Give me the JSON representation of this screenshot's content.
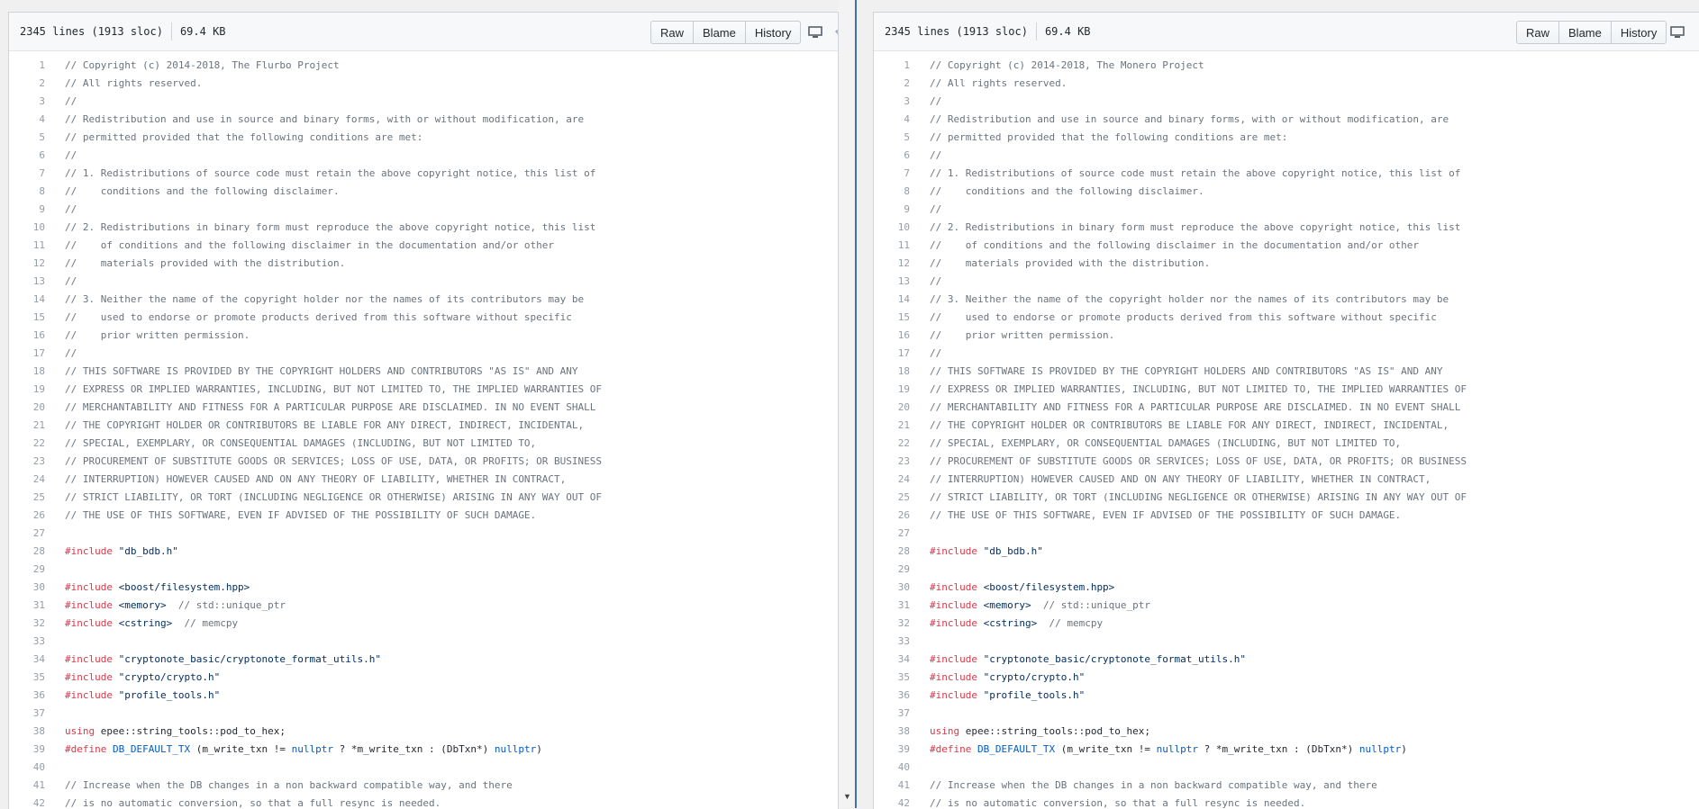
{
  "file_info": {
    "lines": "2345 lines (1913 sloc)",
    "size": "69.4 KB"
  },
  "buttons": {
    "raw": "Raw",
    "blame": "Blame",
    "history": "History"
  },
  "left": {
    "rows": [
      {
        "n": "1",
        "t": [
          {
            "c": "c",
            "v": "// Copyright (c) 2014-2018, The Flurbo Project"
          }
        ]
      },
      {
        "n": "2",
        "t": [
          {
            "c": "c",
            "v": "// All rights reserved."
          }
        ]
      },
      {
        "n": "3",
        "t": [
          {
            "c": "c",
            "v": "//"
          }
        ]
      },
      {
        "n": "4",
        "t": [
          {
            "c": "c",
            "v": "// Redistribution and use in source and binary forms, with or without modification, are"
          }
        ]
      },
      {
        "n": "5",
        "t": [
          {
            "c": "c",
            "v": "// permitted provided that the following conditions are met:"
          }
        ]
      },
      {
        "n": "6",
        "t": [
          {
            "c": "c",
            "v": "//"
          }
        ]
      },
      {
        "n": "7",
        "t": [
          {
            "c": "c",
            "v": "// 1. Redistributions of source code must retain the above copyright notice, this list of"
          }
        ]
      },
      {
        "n": "8",
        "t": [
          {
            "c": "c",
            "v": "//    conditions and the following disclaimer."
          }
        ]
      },
      {
        "n": "9",
        "t": [
          {
            "c": "c",
            "v": "//"
          }
        ]
      },
      {
        "n": "10",
        "t": [
          {
            "c": "c",
            "v": "// 2. Redistributions in binary form must reproduce the above copyright notice, this list"
          }
        ]
      },
      {
        "n": "11",
        "t": [
          {
            "c": "c",
            "v": "//    of conditions and the following disclaimer in the documentation and/or other"
          }
        ]
      },
      {
        "n": "12",
        "t": [
          {
            "c": "c",
            "v": "//    materials provided with the distribution."
          }
        ]
      },
      {
        "n": "13",
        "t": [
          {
            "c": "c",
            "v": "//"
          }
        ]
      },
      {
        "n": "14",
        "t": [
          {
            "c": "c",
            "v": "// 3. Neither the name of the copyright holder nor the names of its contributors may be"
          }
        ]
      },
      {
        "n": "15",
        "t": [
          {
            "c": "c",
            "v": "//    used to endorse or promote products derived from this software without specific"
          }
        ]
      },
      {
        "n": "16",
        "t": [
          {
            "c": "c",
            "v": "//    prior written permission."
          }
        ]
      },
      {
        "n": "17",
        "t": [
          {
            "c": "c",
            "v": "//"
          }
        ]
      },
      {
        "n": "18",
        "t": [
          {
            "c": "c",
            "v": "// THIS SOFTWARE IS PROVIDED BY THE COPYRIGHT HOLDERS AND CONTRIBUTORS \"AS IS\" AND ANY"
          }
        ]
      },
      {
        "n": "19",
        "t": [
          {
            "c": "c",
            "v": "// EXPRESS OR IMPLIED WARRANTIES, INCLUDING, BUT NOT LIMITED TO, THE IMPLIED WARRANTIES OF"
          }
        ]
      },
      {
        "n": "20",
        "t": [
          {
            "c": "c",
            "v": "// MERCHANTABILITY AND FITNESS FOR A PARTICULAR PURPOSE ARE DISCLAIMED. IN NO EVENT SHALL"
          }
        ]
      },
      {
        "n": "21",
        "t": [
          {
            "c": "c",
            "v": "// THE COPYRIGHT HOLDER OR CONTRIBUTORS BE LIABLE FOR ANY DIRECT, INDIRECT, INCIDENTAL,"
          }
        ]
      },
      {
        "n": "22",
        "t": [
          {
            "c": "c",
            "v": "// SPECIAL, EXEMPLARY, OR CONSEQUENTIAL DAMAGES (INCLUDING, BUT NOT LIMITED TO,"
          }
        ]
      },
      {
        "n": "23",
        "t": [
          {
            "c": "c",
            "v": "// PROCUREMENT OF SUBSTITUTE GOODS OR SERVICES; LOSS OF USE, DATA, OR PROFITS; OR BUSINESS"
          }
        ]
      },
      {
        "n": "24",
        "t": [
          {
            "c": "c",
            "v": "// INTERRUPTION) HOWEVER CAUSED AND ON ANY THEORY OF LIABILITY, WHETHER IN CONTRACT,"
          }
        ]
      },
      {
        "n": "25",
        "t": [
          {
            "c": "c",
            "v": "// STRICT LIABILITY, OR TORT (INCLUDING NEGLIGENCE OR OTHERWISE) ARISING IN ANY WAY OUT OF"
          }
        ]
      },
      {
        "n": "26",
        "t": [
          {
            "c": "c",
            "v": "// THE USE OF THIS SOFTWARE, EVEN IF ADVISED OF THE POSSIBILITY OF SUCH DAMAGE."
          }
        ]
      },
      {
        "n": "27",
        "t": []
      },
      {
        "n": "28",
        "t": [
          {
            "c": "k",
            "v": "#include"
          },
          {
            "c": "",
            "v": " "
          },
          {
            "c": "s",
            "v": "\"db_bdb.h\""
          }
        ]
      },
      {
        "n": "29",
        "t": []
      },
      {
        "n": "30",
        "t": [
          {
            "c": "k",
            "v": "#include"
          },
          {
            "c": "",
            "v": " "
          },
          {
            "c": "s",
            "v": "<boost/filesystem.hpp>"
          }
        ]
      },
      {
        "n": "31",
        "t": [
          {
            "c": "k",
            "v": "#include"
          },
          {
            "c": "",
            "v": " "
          },
          {
            "c": "s",
            "v": "<memory>"
          },
          {
            "c": "c",
            "v": "  // std::unique_ptr"
          }
        ]
      },
      {
        "n": "32",
        "t": [
          {
            "c": "k",
            "v": "#include"
          },
          {
            "c": "",
            "v": " "
          },
          {
            "c": "s",
            "v": "<cstring>"
          },
          {
            "c": "c",
            "v": "  // memcpy"
          }
        ]
      },
      {
        "n": "33",
        "t": []
      },
      {
        "n": "34",
        "t": [
          {
            "c": "k",
            "v": "#include"
          },
          {
            "c": "",
            "v": " "
          },
          {
            "c": "s",
            "v": "\"cryptonote_basic/cryptonote_format_utils.h\""
          }
        ]
      },
      {
        "n": "35",
        "t": [
          {
            "c": "k",
            "v": "#include"
          },
          {
            "c": "",
            "v": " "
          },
          {
            "c": "s",
            "v": "\"crypto/crypto.h\""
          }
        ]
      },
      {
        "n": "36",
        "t": [
          {
            "c": "k",
            "v": "#include"
          },
          {
            "c": "",
            "v": " "
          },
          {
            "c": "s",
            "v": "\"profile_tools.h\""
          }
        ]
      },
      {
        "n": "37",
        "t": []
      },
      {
        "n": "38",
        "t": [
          {
            "c": "k",
            "v": "using"
          },
          {
            "c": "",
            "v": " epee::string_tools::pod_to_hex;"
          }
        ]
      },
      {
        "n": "39",
        "t": [
          {
            "c": "k",
            "v": "#define"
          },
          {
            "c": "",
            "v": " "
          },
          {
            "c": "n",
            "v": "DB_DEFAULT_TX"
          },
          {
            "c": "",
            "v": " (m_write_txn != "
          },
          {
            "c": "n",
            "v": "nullptr"
          },
          {
            "c": "",
            "v": " ? *m_write_txn : (DbTxn*) "
          },
          {
            "c": "n",
            "v": "nullptr"
          },
          {
            "c": "",
            "v": ")"
          }
        ]
      },
      {
        "n": "40",
        "t": []
      },
      {
        "n": "41",
        "t": [
          {
            "c": "c",
            "v": "// Increase when the DB changes in a non backward compatible way, and there"
          }
        ]
      },
      {
        "n": "42",
        "t": [
          {
            "c": "c",
            "v": "// is no automatic conversion, so that a full resync is needed."
          }
        ]
      }
    ]
  },
  "right": {
    "rows": [
      {
        "n": "1",
        "t": [
          {
            "c": "c",
            "v": "// Copyright (c) 2014-2018, The Monero Project"
          }
        ]
      },
      {
        "n": "2",
        "t": [
          {
            "c": "c",
            "v": "// All rights reserved."
          }
        ]
      },
      {
        "n": "3",
        "t": [
          {
            "c": "c",
            "v": "//"
          }
        ]
      },
      {
        "n": "4",
        "t": [
          {
            "c": "c",
            "v": "// Redistribution and use in source and binary forms, with or without modification, are"
          }
        ]
      },
      {
        "n": "5",
        "t": [
          {
            "c": "c",
            "v": "// permitted provided that the following conditions are met:"
          }
        ]
      },
      {
        "n": "6",
        "t": [
          {
            "c": "c",
            "v": "//"
          }
        ]
      },
      {
        "n": "7",
        "t": [
          {
            "c": "c",
            "v": "// 1. Redistributions of source code must retain the above copyright notice, this list of"
          }
        ]
      },
      {
        "n": "8",
        "t": [
          {
            "c": "c",
            "v": "//    conditions and the following disclaimer."
          }
        ]
      },
      {
        "n": "9",
        "t": [
          {
            "c": "c",
            "v": "//"
          }
        ]
      },
      {
        "n": "10",
        "t": [
          {
            "c": "c",
            "v": "// 2. Redistributions in binary form must reproduce the above copyright notice, this list"
          }
        ]
      },
      {
        "n": "11",
        "t": [
          {
            "c": "c",
            "v": "//    of conditions and the following disclaimer in the documentation and/or other"
          }
        ]
      },
      {
        "n": "12",
        "t": [
          {
            "c": "c",
            "v": "//    materials provided with the distribution."
          }
        ]
      },
      {
        "n": "13",
        "t": [
          {
            "c": "c",
            "v": "//"
          }
        ]
      },
      {
        "n": "14",
        "t": [
          {
            "c": "c",
            "v": "// 3. Neither the name of the copyright holder nor the names of its contributors may be"
          }
        ]
      },
      {
        "n": "15",
        "t": [
          {
            "c": "c",
            "v": "//    used to endorse or promote products derived from this software without specific"
          }
        ]
      },
      {
        "n": "16",
        "t": [
          {
            "c": "c",
            "v": "//    prior written permission."
          }
        ]
      },
      {
        "n": "17",
        "t": [
          {
            "c": "c",
            "v": "//"
          }
        ]
      },
      {
        "n": "18",
        "t": [
          {
            "c": "c",
            "v": "// THIS SOFTWARE IS PROVIDED BY THE COPYRIGHT HOLDERS AND CONTRIBUTORS \"AS IS\" AND ANY"
          }
        ]
      },
      {
        "n": "19",
        "t": [
          {
            "c": "c",
            "v": "// EXPRESS OR IMPLIED WARRANTIES, INCLUDING, BUT NOT LIMITED TO, THE IMPLIED WARRANTIES OF"
          }
        ]
      },
      {
        "n": "20",
        "t": [
          {
            "c": "c",
            "v": "// MERCHANTABILITY AND FITNESS FOR A PARTICULAR PURPOSE ARE DISCLAIMED. IN NO EVENT SHALL"
          }
        ]
      },
      {
        "n": "21",
        "t": [
          {
            "c": "c",
            "v": "// THE COPYRIGHT HOLDER OR CONTRIBUTORS BE LIABLE FOR ANY DIRECT, INDIRECT, INCIDENTAL,"
          }
        ]
      },
      {
        "n": "22",
        "t": [
          {
            "c": "c",
            "v": "// SPECIAL, EXEMPLARY, OR CONSEQUENTIAL DAMAGES (INCLUDING, BUT NOT LIMITED TO,"
          }
        ]
      },
      {
        "n": "23",
        "t": [
          {
            "c": "c",
            "v": "// PROCUREMENT OF SUBSTITUTE GOODS OR SERVICES; LOSS OF USE, DATA, OR PROFITS; OR BUSINESS"
          }
        ]
      },
      {
        "n": "24",
        "t": [
          {
            "c": "c",
            "v": "// INTERRUPTION) HOWEVER CAUSED AND ON ANY THEORY OF LIABILITY, WHETHER IN CONTRACT,"
          }
        ]
      },
      {
        "n": "25",
        "t": [
          {
            "c": "c",
            "v": "// STRICT LIABILITY, OR TORT (INCLUDING NEGLIGENCE OR OTHERWISE) ARISING IN ANY WAY OUT OF"
          }
        ]
      },
      {
        "n": "26",
        "t": [
          {
            "c": "c",
            "v": "// THE USE OF THIS SOFTWARE, EVEN IF ADVISED OF THE POSSIBILITY OF SUCH DAMAGE."
          }
        ]
      },
      {
        "n": "27",
        "t": []
      },
      {
        "n": "28",
        "t": [
          {
            "c": "k",
            "v": "#include"
          },
          {
            "c": "",
            "v": " "
          },
          {
            "c": "s",
            "v": "\"db_bdb.h\""
          }
        ]
      },
      {
        "n": "29",
        "t": []
      },
      {
        "n": "30",
        "t": [
          {
            "c": "k",
            "v": "#include"
          },
          {
            "c": "",
            "v": " "
          },
          {
            "c": "s",
            "v": "<boost/filesystem.hpp>"
          }
        ]
      },
      {
        "n": "31",
        "t": [
          {
            "c": "k",
            "v": "#include"
          },
          {
            "c": "",
            "v": " "
          },
          {
            "c": "s",
            "v": "<memory>"
          },
          {
            "c": "c",
            "v": "  // std::unique_ptr"
          }
        ]
      },
      {
        "n": "32",
        "t": [
          {
            "c": "k",
            "v": "#include"
          },
          {
            "c": "",
            "v": " "
          },
          {
            "c": "s",
            "v": "<cstring>"
          },
          {
            "c": "c",
            "v": "  // memcpy"
          }
        ]
      },
      {
        "n": "33",
        "t": []
      },
      {
        "n": "34",
        "t": [
          {
            "c": "k",
            "v": "#include"
          },
          {
            "c": "",
            "v": " "
          },
          {
            "c": "s",
            "v": "\"cryptonote_basic/cryptonote_format_utils.h\""
          }
        ]
      },
      {
        "n": "35",
        "t": [
          {
            "c": "k",
            "v": "#include"
          },
          {
            "c": "",
            "v": " "
          },
          {
            "c": "s",
            "v": "\"crypto/crypto.h\""
          }
        ]
      },
      {
        "n": "36",
        "t": [
          {
            "c": "k",
            "v": "#include"
          },
          {
            "c": "",
            "v": " "
          },
          {
            "c": "s",
            "v": "\"profile_tools.h\""
          }
        ]
      },
      {
        "n": "37",
        "t": []
      },
      {
        "n": "38",
        "t": [
          {
            "c": "k",
            "v": "using"
          },
          {
            "c": "",
            "v": " epee::string_tools::pod_to_hex;"
          }
        ]
      },
      {
        "n": "39",
        "t": [
          {
            "c": "k",
            "v": "#define"
          },
          {
            "c": "",
            "v": " "
          },
          {
            "c": "n",
            "v": "DB_DEFAULT_TX"
          },
          {
            "c": "",
            "v": " (m_write_txn != "
          },
          {
            "c": "n",
            "v": "nullptr"
          },
          {
            "c": "",
            "v": " ? *m_write_txn : (DbTxn*) "
          },
          {
            "c": "n",
            "v": "nullptr"
          },
          {
            "c": "",
            "v": ")"
          }
        ]
      },
      {
        "n": "40",
        "t": []
      },
      {
        "n": "41",
        "t": [
          {
            "c": "c",
            "v": "// Increase when the DB changes in a non backward compatible way, and there"
          }
        ]
      },
      {
        "n": "42",
        "t": [
          {
            "c": "c",
            "v": "// is no automatic conversion, so that a full resync is needed."
          }
        ]
      }
    ]
  },
  "icons": {
    "display": "monitor-icon",
    "edit": "pencil-icon",
    "scroll": "scroll-down-arrow-icon"
  },
  "colors": {
    "comment": "#6a737d",
    "keyword": "#d73a49",
    "string": "#032f62",
    "constant": "#005cc5",
    "divider": "#3f73b4"
  }
}
